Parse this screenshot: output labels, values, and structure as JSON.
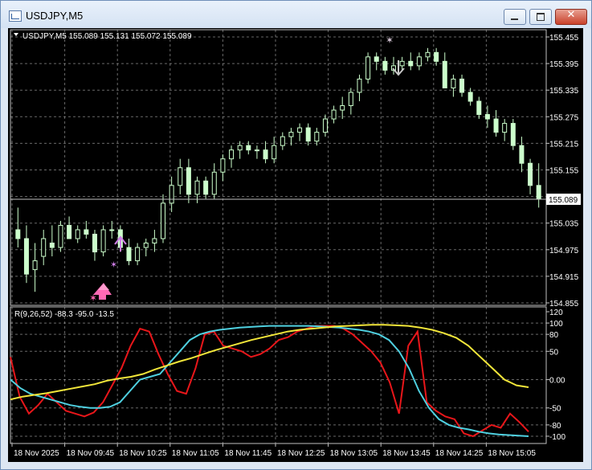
{
  "window": {
    "title": "USDJPY,M5",
    "minimize_glyph": "",
    "maximize_glyph": "",
    "close_glyph": "✕"
  },
  "colors": {
    "background": "#000000",
    "candle": "#ccffcc",
    "grid": "#c0c0c0",
    "rsi_red": "#e8161a",
    "rsi_cyan": "#4fd0e0",
    "rsi_yellow": "#f2e63a",
    "buy_arrow": "#ff69b4",
    "buy_arrow_2": "#d07fe8",
    "sell_arrow": "#c8c8c8"
  },
  "main": {
    "header": "USDJPY,M5  155.089 155.131 155.072 155.089",
    "price_label": "155.089",
    "price_ticks": [
      "155.455",
      "155.395",
      "155.335",
      "155.275",
      "155.215",
      "155.155",
      "155.095",
      "155.035",
      "154.975",
      "154.915",
      "154.855"
    ]
  },
  "indicator": {
    "header": "R(9,26,52) -88.3 -95.0 -13.5",
    "ticks": [
      "120",
      "100",
      "80",
      "50",
      "0.00",
      "-50",
      "-80",
      "-100"
    ]
  },
  "time_axis": {
    "labels": [
      "18 Nov 2025",
      "18 Nov 09:45",
      "18 Nov 10:25",
      "18 Nov 11:05",
      "18 Nov 11:45",
      "18 Nov 12:25",
      "18 Nov 13:05",
      "18 Nov 13:45",
      "18 Nov 14:25",
      "18 Nov 15:05"
    ]
  },
  "chart_data": [
    {
      "type": "candlestick",
      "title": "USDJPY,M5",
      "ylim": [
        154.855,
        155.455
      ],
      "ohlc": [
        {
          "o": 155.02,
          "h": 155.07,
          "l": 154.98,
          "c": 155.0
        },
        {
          "o": 155.0,
          "h": 155.03,
          "l": 154.9,
          "c": 154.92
        },
        {
          "o": 154.93,
          "h": 154.99,
          "l": 154.88,
          "c": 154.95
        },
        {
          "o": 154.96,
          "h": 155.02,
          "l": 154.94,
          "c": 155.0
        },
        {
          "o": 154.99,
          "h": 155.03,
          "l": 154.96,
          "c": 154.98
        },
        {
          "o": 154.98,
          "h": 155.04,
          "l": 154.97,
          "c": 155.03
        },
        {
          "o": 155.03,
          "h": 155.05,
          "l": 155.0,
          "c": 155.0
        },
        {
          "o": 155.0,
          "h": 155.03,
          "l": 154.99,
          "c": 155.02
        },
        {
          "o": 155.02,
          "h": 155.04,
          "l": 155.0,
          "c": 155.01
        },
        {
          "o": 155.01,
          "h": 155.02,
          "l": 154.95,
          "c": 154.97
        },
        {
          "o": 154.97,
          "h": 155.03,
          "l": 154.96,
          "c": 155.02
        },
        {
          "o": 155.02,
          "h": 155.04,
          "l": 155.0,
          "c": 155.02
        },
        {
          "o": 155.02,
          "h": 155.03,
          "l": 154.97,
          "c": 154.98
        },
        {
          "o": 154.98,
          "h": 155.0,
          "l": 154.94,
          "c": 154.95
        },
        {
          "o": 154.95,
          "h": 154.99,
          "l": 154.94,
          "c": 154.98
        },
        {
          "o": 154.98,
          "h": 155.0,
          "l": 154.96,
          "c": 154.99
        },
        {
          "o": 154.99,
          "h": 155.02,
          "l": 154.97,
          "c": 155.0
        },
        {
          "o": 155.0,
          "h": 155.1,
          "l": 154.99,
          "c": 155.08
        },
        {
          "o": 155.08,
          "h": 155.14,
          "l": 155.06,
          "c": 155.12
        },
        {
          "o": 155.12,
          "h": 155.18,
          "l": 155.1,
          "c": 155.16
        },
        {
          "o": 155.16,
          "h": 155.18,
          "l": 155.08,
          "c": 155.1
        },
        {
          "o": 155.1,
          "h": 155.14,
          "l": 155.08,
          "c": 155.13
        },
        {
          "o": 155.13,
          "h": 155.14,
          "l": 155.09,
          "c": 155.1
        },
        {
          "o": 155.1,
          "h": 155.17,
          "l": 155.09,
          "c": 155.15
        },
        {
          "o": 155.15,
          "h": 155.19,
          "l": 155.13,
          "c": 155.18
        },
        {
          "o": 155.18,
          "h": 155.21,
          "l": 155.16,
          "c": 155.2
        },
        {
          "o": 155.2,
          "h": 155.22,
          "l": 155.18,
          "c": 155.21
        },
        {
          "o": 155.21,
          "h": 155.22,
          "l": 155.19,
          "c": 155.2
        },
        {
          "o": 155.2,
          "h": 155.21,
          "l": 155.18,
          "c": 155.2
        },
        {
          "o": 155.2,
          "h": 155.22,
          "l": 155.17,
          "c": 155.18
        },
        {
          "o": 155.18,
          "h": 155.23,
          "l": 155.17,
          "c": 155.21
        },
        {
          "o": 155.21,
          "h": 155.24,
          "l": 155.2,
          "c": 155.23
        },
        {
          "o": 155.23,
          "h": 155.25,
          "l": 155.21,
          "c": 155.24
        },
        {
          "o": 155.24,
          "h": 155.26,
          "l": 155.22,
          "c": 155.25
        },
        {
          "o": 155.25,
          "h": 155.26,
          "l": 155.21,
          "c": 155.22
        },
        {
          "o": 155.22,
          "h": 155.25,
          "l": 155.21,
          "c": 155.24
        },
        {
          "o": 155.24,
          "h": 155.28,
          "l": 155.23,
          "c": 155.27
        },
        {
          "o": 155.27,
          "h": 155.3,
          "l": 155.26,
          "c": 155.29
        },
        {
          "o": 155.29,
          "h": 155.32,
          "l": 155.27,
          "c": 155.3
        },
        {
          "o": 155.3,
          "h": 155.34,
          "l": 155.28,
          "c": 155.33
        },
        {
          "o": 155.33,
          "h": 155.37,
          "l": 155.31,
          "c": 155.36
        },
        {
          "o": 155.36,
          "h": 155.42,
          "l": 155.35,
          "c": 155.41
        },
        {
          "o": 155.41,
          "h": 155.42,
          "l": 155.38,
          "c": 155.4
        },
        {
          "o": 155.4,
          "h": 155.41,
          "l": 155.37,
          "c": 155.38
        },
        {
          "o": 155.38,
          "h": 155.41,
          "l": 155.37,
          "c": 155.39
        },
        {
          "o": 155.39,
          "h": 155.41,
          "l": 155.38,
          "c": 155.4
        },
        {
          "o": 155.4,
          "h": 155.42,
          "l": 155.38,
          "c": 155.39
        },
        {
          "o": 155.39,
          "h": 155.42,
          "l": 155.38,
          "c": 155.41
        },
        {
          "o": 155.41,
          "h": 155.43,
          "l": 155.4,
          "c": 155.42
        },
        {
          "o": 155.42,
          "h": 155.43,
          "l": 155.39,
          "c": 155.4
        },
        {
          "o": 155.4,
          "h": 155.42,
          "l": 155.37,
          "c": 155.34
        },
        {
          "o": 155.34,
          "h": 155.37,
          "l": 155.32,
          "c": 155.36
        },
        {
          "o": 155.36,
          "h": 155.37,
          "l": 155.32,
          "c": 155.33
        },
        {
          "o": 155.33,
          "h": 155.34,
          "l": 155.3,
          "c": 155.31
        },
        {
          "o": 155.31,
          "h": 155.32,
          "l": 155.27,
          "c": 155.28
        },
        {
          "o": 155.28,
          "h": 155.3,
          "l": 155.25,
          "c": 155.27
        },
        {
          "o": 155.27,
          "h": 155.29,
          "l": 155.23,
          "c": 155.24
        },
        {
          "o": 155.24,
          "h": 155.27,
          "l": 155.22,
          "c": 155.26
        },
        {
          "o": 155.26,
          "h": 155.27,
          "l": 155.2,
          "c": 155.21
        },
        {
          "o": 155.21,
          "h": 155.23,
          "l": 155.15,
          "c": 155.17
        },
        {
          "o": 155.17,
          "h": 155.18,
          "l": 155.1,
          "c": 155.12
        },
        {
          "o": 155.12,
          "h": 155.17,
          "l": 155.07,
          "c": 155.09
        }
      ]
    },
    {
      "type": "line",
      "title": "R(9,26,52)",
      "ylim": [
        -110,
        120
      ],
      "series": [
        {
          "name": "9",
          "color": "#e8161a",
          "values": [
            40,
            -30,
            -60,
            -45,
            -25,
            -40,
            -55,
            -60,
            -65,
            -58,
            -40,
            -10,
            20,
            60,
            90,
            85,
            45,
            10,
            -20,
            -25,
            20,
            80,
            85,
            60,
            55,
            50,
            40,
            45,
            55,
            70,
            75,
            85,
            90,
            95,
            95,
            95,
            90,
            80,
            65,
            50,
            30,
            -5,
            -60,
            60,
            85,
            -40,
            -55,
            -65,
            -70,
            -95,
            -100,
            -90,
            -80,
            -85,
            -60,
            -75,
            -92
          ]
        },
        {
          "name": "26",
          "color": "#4fd0e0",
          "values": [
            0,
            -15,
            -25,
            -30,
            -35,
            -40,
            -45,
            -48,
            -50,
            -50,
            -48,
            -40,
            -20,
            0,
            5,
            10,
            30,
            50,
            70,
            80,
            85,
            88,
            90,
            92,
            93,
            94,
            95,
            95,
            95,
            95,
            95,
            94,
            93,
            92,
            90,
            88,
            85,
            80,
            70,
            50,
            20,
            -20,
            -50,
            -70,
            -80,
            -85,
            -88,
            -92,
            -95,
            -97,
            -98,
            -99,
            -100
          ]
        },
        {
          "name": "52",
          "color": "#f2e63a",
          "values": [
            -35,
            -30,
            -27,
            -24,
            -20,
            -16,
            -12,
            -8,
            -2,
            2,
            5,
            10,
            18,
            25,
            32,
            38,
            45,
            52,
            58,
            64,
            70,
            75,
            80,
            85,
            88,
            90,
            92,
            94,
            95,
            96,
            97,
            97,
            96,
            95,
            92,
            88,
            82,
            74,
            60,
            40,
            20,
            0,
            -10,
            -13.5
          ]
        }
      ]
    }
  ]
}
